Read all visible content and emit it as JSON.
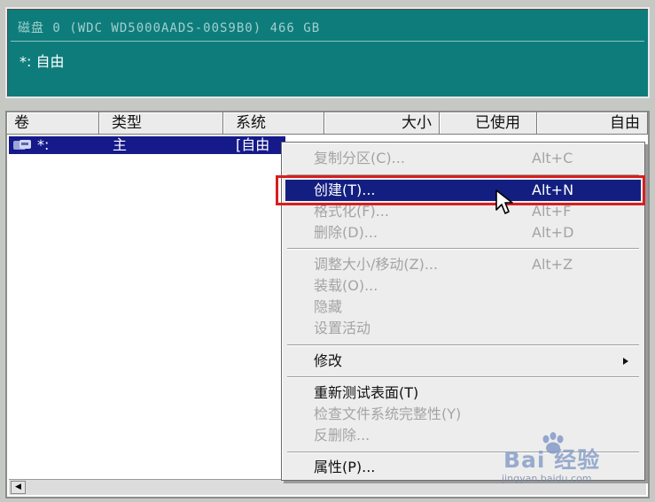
{
  "disk_panel": {
    "title": "磁盘 0 (WDC WD5000AADS-00S9B0) 466 GB",
    "partition_tag": "*: 自由"
  },
  "columns": [
    {
      "label": "卷"
    },
    {
      "label": "类型"
    },
    {
      "label": "系统"
    },
    {
      "label": "大小"
    },
    {
      "label": "已使用"
    },
    {
      "label": "自由"
    }
  ],
  "selected_row": {
    "volume": "*:",
    "type": "主",
    "system": "[自由"
  },
  "context_menu": {
    "items": [
      {
        "label": "复制分区(C)...",
        "shortcut": "Alt+C",
        "disabled": true
      },
      {
        "label": "创建(T)...",
        "shortcut": "Alt+N",
        "disabled": false,
        "highlighted": true
      },
      {
        "label": "格式化(F)...",
        "shortcut": "Alt+F",
        "disabled": true
      },
      {
        "label": "删除(D)...",
        "shortcut": "Alt+D",
        "disabled": true
      },
      {
        "label": "调整大小/移动(Z)...",
        "shortcut": "Alt+Z",
        "disabled": true
      },
      {
        "label": "装载(O)...",
        "shortcut": "",
        "disabled": true
      },
      {
        "label": "隐藏",
        "shortcut": "",
        "disabled": true
      },
      {
        "label": "设置活动",
        "shortcut": "",
        "disabled": true
      },
      {
        "label": "修改",
        "shortcut": "",
        "disabled": false,
        "submenu": true
      },
      {
        "label": "重新测试表面(T)",
        "shortcut": "",
        "disabled": false
      },
      {
        "label": "检查文件系统完整性(Y)",
        "shortcut": "",
        "disabled": true
      },
      {
        "label": "反删除...",
        "shortcut": "",
        "disabled": true
      },
      {
        "label": "属性(P)...",
        "shortcut": "",
        "disabled": false
      }
    ]
  },
  "watermark": {
    "brand": "Bai 经验",
    "url": "jingyan.baidu.com"
  },
  "colors": {
    "disk_panel_bg": "#0e7c7b",
    "selection": "#15198a",
    "menu_highlight": "#131f80",
    "annotation_red": "#d81e1e"
  }
}
